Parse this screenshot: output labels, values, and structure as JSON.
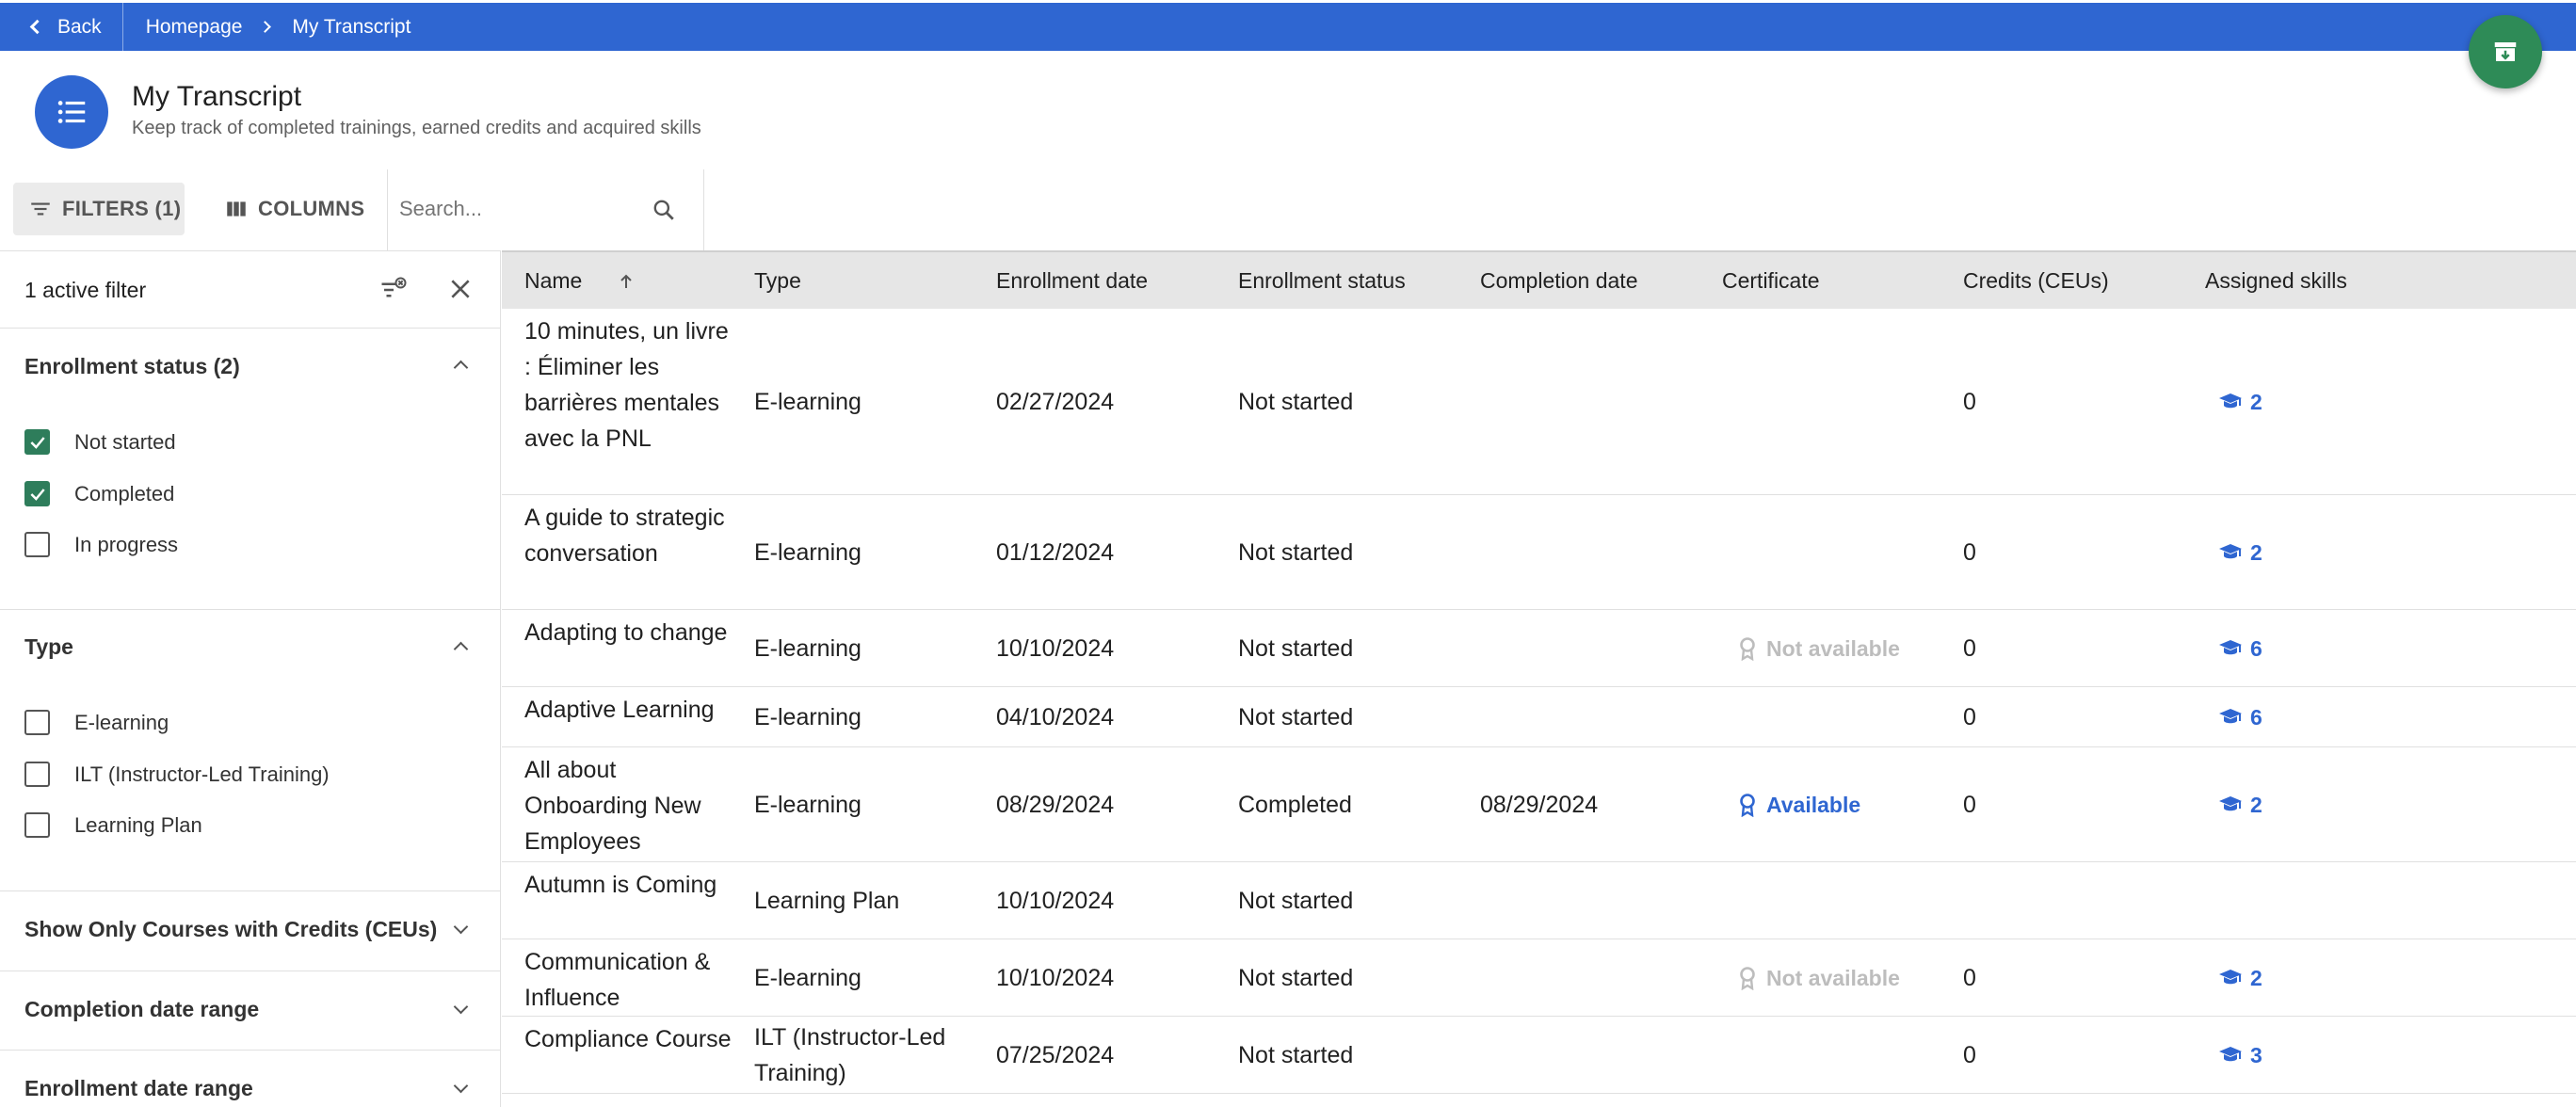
{
  "topbar": {
    "back_label": "Back",
    "breadcrumb": [
      "Homepage",
      "My Transcript"
    ]
  },
  "header": {
    "title": "My Transcript",
    "subtitle": "Keep track of completed trainings, earned credits and acquired skills"
  },
  "toolbar": {
    "filters_label": "FILTERS (1)",
    "columns_label": "COLUMNS",
    "search_placeholder": "Search..."
  },
  "sidebar": {
    "active_filter_label": "1 active filter",
    "enrollment_status": {
      "title": "Enrollment status (2)",
      "options": [
        {
          "label": "Not started",
          "checked": true
        },
        {
          "label": "Completed",
          "checked": true
        },
        {
          "label": "In progress",
          "checked": false
        }
      ]
    },
    "type": {
      "title": "Type",
      "options": [
        {
          "label": "E-learning",
          "checked": false
        },
        {
          "label": "ILT (Instructor-Led Training)",
          "checked": false
        },
        {
          "label": "Learning Plan",
          "checked": false
        }
      ]
    },
    "collapsed_sections": [
      "Show Only Courses with Credits (CEUs)",
      "Completion date range",
      "Enrollment date range"
    ]
  },
  "table": {
    "columns": [
      "Name",
      "Type",
      "Enrollment date",
      "Enrollment status",
      "Completion date",
      "Certificate",
      "Credits (CEUs)",
      "Assigned skills"
    ],
    "rows": [
      {
        "name": "10 minutes, un livre : Éliminer les barrières mentales avec la PNL",
        "type": "E-learning",
        "enrollment_date": "02/27/2024",
        "status": "Not started",
        "completion_date": "",
        "certificate": "",
        "credits": "0",
        "skills": "2"
      },
      {
        "name": "A guide to strategic conversation",
        "type": "E-learning",
        "enrollment_date": "01/12/2024",
        "status": "Not started",
        "completion_date": "",
        "certificate": "",
        "credits": "0",
        "skills": "2"
      },
      {
        "name": "Adapting to change",
        "type": "E-learning",
        "enrollment_date": "10/10/2024",
        "status": "Not started",
        "completion_date": "",
        "certificate": "Not available",
        "credits": "0",
        "skills": "6"
      },
      {
        "name": "Adaptive Learning",
        "type": "E-learning",
        "enrollment_date": "04/10/2024",
        "status": "Not started",
        "completion_date": "",
        "certificate": "",
        "credits": "0",
        "skills": "6"
      },
      {
        "name": "All about Onboarding New Employees",
        "type": "E-learning",
        "enrollment_date": "08/29/2024",
        "status": "Completed",
        "completion_date": "08/29/2024",
        "certificate": "Available",
        "credits": "0",
        "skills": "2"
      },
      {
        "name": "Autumn is Coming",
        "type": "Learning Plan",
        "enrollment_date": "10/10/2024",
        "status": "Not started",
        "completion_date": "",
        "certificate": "",
        "credits": "",
        "skills": ""
      },
      {
        "name": "Communication & Influence",
        "type": "E-learning",
        "enrollment_date": "10/10/2024",
        "status": "Not started",
        "completion_date": "",
        "certificate": "Not available",
        "credits": "0",
        "skills": "2"
      },
      {
        "name": "Compliance Course",
        "type": "ILT (Instructor-Led Training)",
        "enrollment_date": "07/25/2024",
        "status": "Not started",
        "completion_date": "",
        "certificate": "",
        "credits": "0",
        "skills": "3"
      }
    ]
  },
  "colors": {
    "brand_blue": "#2f66d1",
    "fab_green": "#2e8b57",
    "checkbox_green": "#2e7d5b",
    "muted_grey": "#bdbdbd"
  },
  "icons": {
    "fab": "archive-download-icon",
    "page": "list-icon",
    "filters": "filter-lines-icon",
    "columns": "columns-icon",
    "search": "search-icon",
    "clear_filters": "filter-clear-icon",
    "close": "close-icon",
    "certificate": "award-icon",
    "skills": "graduation-cap-icon"
  }
}
